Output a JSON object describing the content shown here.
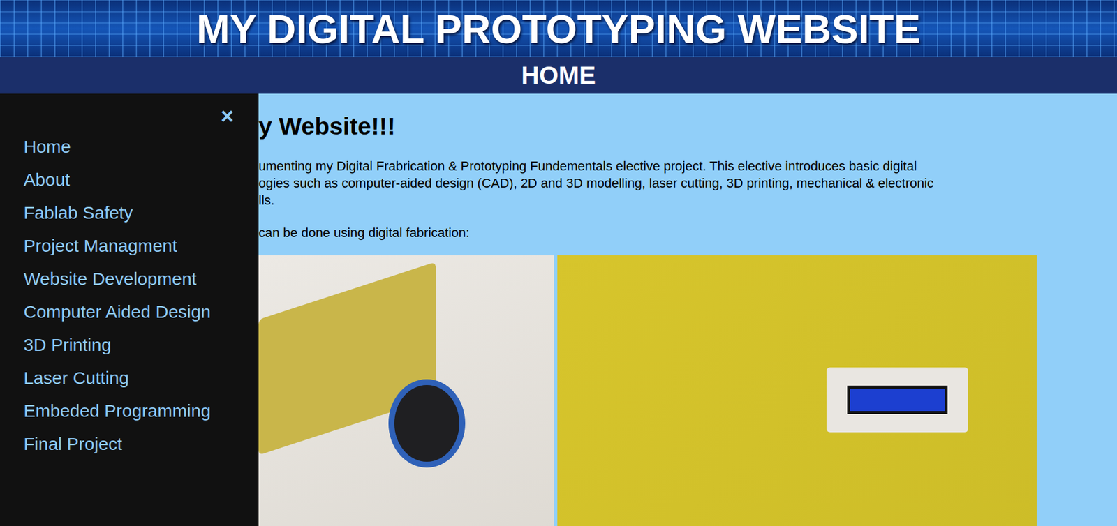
{
  "header": {
    "title": "MY DIGITAL PROTOTYPING WEBSITE"
  },
  "navbar": {
    "title": "HOME"
  },
  "sidenav": {
    "close": "×",
    "items": [
      {
        "label": "Home"
      },
      {
        "label": "About"
      },
      {
        "label": "Fablab Safety"
      },
      {
        "label": "Project Managment"
      },
      {
        "label": "Website Development"
      },
      {
        "label": "Computer Aided Design"
      },
      {
        "label": "3D Printing"
      },
      {
        "label": "Laser Cutting"
      },
      {
        "label": "Embeded Programming"
      },
      {
        "label": "Final Project"
      }
    ]
  },
  "content": {
    "heading": "y Website!!!",
    "paragraphs": [
      [
        "umenting my Digital Frabrication & Prototyping Fundementals elective project. This elective introduces basic digital",
        "ogies such as computer-aided design (CAD), 2D and 3D modelling, laser cutting, 3D printing, mechanical & electronic",
        "lls."
      ],
      [
        "can be done using digital fabrication:"
      ]
    ]
  }
}
